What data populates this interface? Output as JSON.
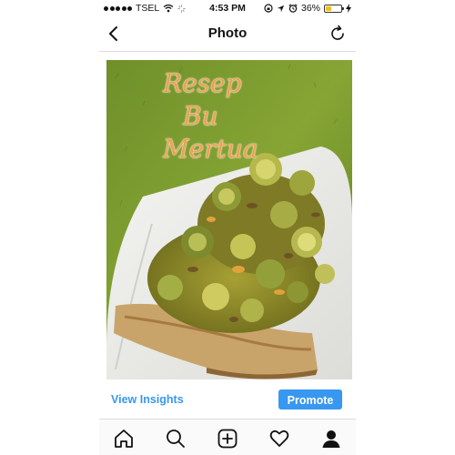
{
  "status_bar": {
    "carrier": "TSEL",
    "time": "4:53 PM",
    "battery_percent": "36%",
    "battery_level": 0.36,
    "battery_fill_color": "#f5c000",
    "icons": [
      "signal-dots-icon",
      "wifi-icon",
      "activity-spinner-icon",
      "screen-lock-icon",
      "location-arrow-icon",
      "alarm-icon",
      "battery-icon",
      "charging-bolt-icon"
    ]
  },
  "nav": {
    "title": "Photo",
    "back_icon": "chevron-left-icon",
    "refresh_icon": "refresh-icon"
  },
  "photo": {
    "caption_lines": [
      "Resep",
      "Bu",
      "Mertua"
    ],
    "caption_color": "#f0a050"
  },
  "actions": {
    "insights_label": "View Insights",
    "promote_label": "Promote",
    "accent_color": "#3897f0"
  },
  "tab_bar": {
    "items": [
      "home-icon",
      "search-icon",
      "add-post-icon",
      "activity-heart-icon",
      "profile-icon"
    ]
  }
}
